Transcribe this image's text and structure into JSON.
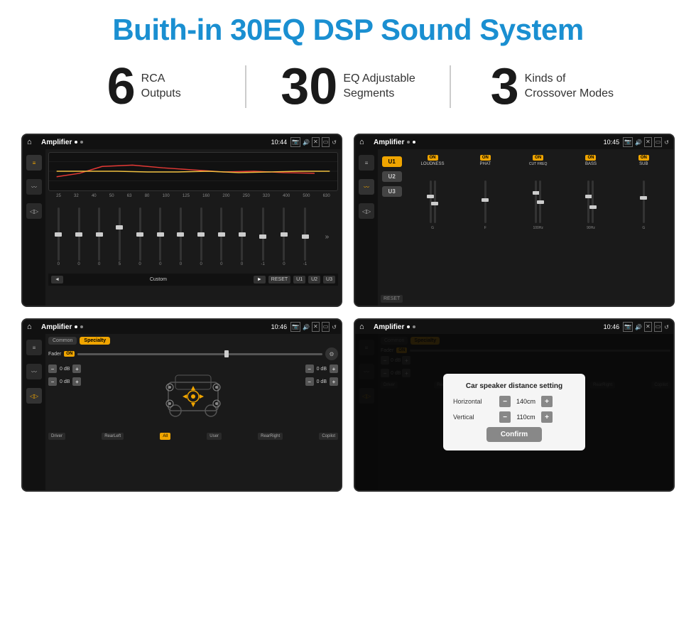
{
  "header": {
    "title": "Buith-in 30EQ DSP Sound System"
  },
  "stats": [
    {
      "number": "6",
      "label": "RCA\nOutputs"
    },
    {
      "number": "30",
      "label": "EQ Adjustable\nSegments"
    },
    {
      "number": "3",
      "label": "Kinds of\nCrossover Modes"
    }
  ],
  "screens": [
    {
      "id": "screen1",
      "statusBar": {
        "appName": "Amplifier",
        "time": "10:44"
      }
    },
    {
      "id": "screen2",
      "statusBar": {
        "appName": "Amplifier",
        "time": "10:45"
      }
    },
    {
      "id": "screen3",
      "statusBar": {
        "appName": "Amplifier",
        "time": "10:46"
      }
    },
    {
      "id": "screen4",
      "statusBar": {
        "appName": "Amplifier",
        "time": "10:46"
      },
      "dialog": {
        "title": "Car speaker distance setting",
        "fields": [
          {
            "label": "Horizontal",
            "value": "140cm"
          },
          {
            "label": "Vertical",
            "value": "110cm"
          }
        ],
        "confirmLabel": "Confirm"
      }
    }
  ],
  "eq": {
    "frequencies": [
      "25",
      "32",
      "40",
      "50",
      "63",
      "80",
      "100",
      "125",
      "160",
      "200",
      "250",
      "320",
      "400",
      "500",
      "630"
    ],
    "values": [
      "0",
      "0",
      "0",
      "5",
      "0",
      "0",
      "0",
      "0",
      "0",
      "0",
      "-1",
      "0",
      "-1"
    ],
    "presets": {
      "customLabel": "Custom",
      "resetLabel": "RESET",
      "u1": "U1",
      "u2": "U2",
      "u3": "U3"
    }
  },
  "amp": {
    "presets": [
      "U1",
      "U2",
      "U3"
    ],
    "controls": [
      "LOUDNESS",
      "PHAT",
      "CUT FREQ",
      "BASS",
      "SUB"
    ],
    "onLabel": "ON",
    "resetLabel": "RESET"
  },
  "crossover": {
    "tabs": [
      "Common",
      "Specialty"
    ],
    "faderLabel": "Fader",
    "onLabel": "ON",
    "bottomLabels": [
      "Driver",
      "RearLeft",
      "All",
      "User",
      "RearRight",
      "Copilot"
    ],
    "driverLabel": "Driver",
    "copilotLabel": "Copilot",
    "rearLeftLabel": "RearLeft",
    "allLabel": "All",
    "userLabel": "User",
    "rearRightLabel": "RearRight"
  },
  "dialog": {
    "title": "Car speaker distance setting",
    "horizontalLabel": "Horizontal",
    "horizontalValue": "140cm",
    "verticalLabel": "Vertical",
    "verticalValue": "110cm",
    "confirmLabel": "Confirm"
  }
}
